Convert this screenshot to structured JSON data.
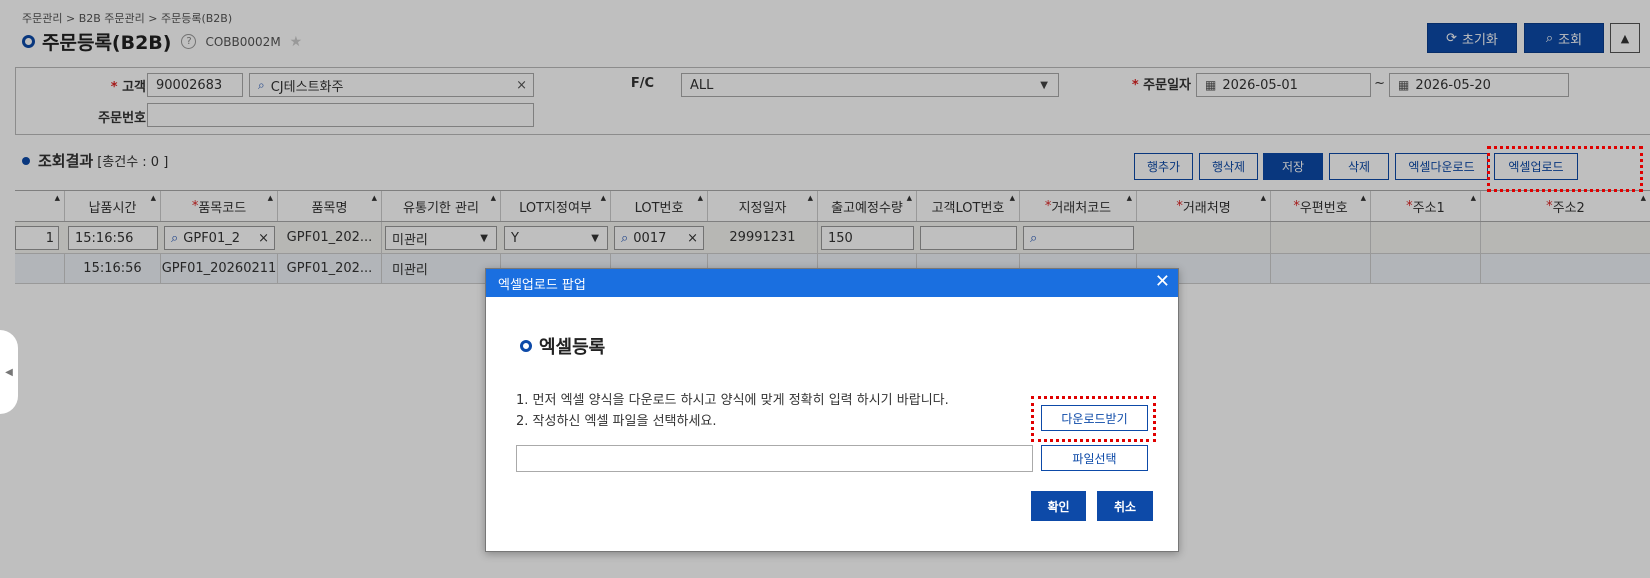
{
  "breadcrumb": "주문관리 > B2B 주문관리 > 주문등록(B2B)",
  "page": {
    "title": "주문등록(B2B)",
    "screen_code": "COBB0002M",
    "help": "?",
    "star": "★"
  },
  "top_buttons": {
    "reset_label": "초기화",
    "reset_icon": "⟳",
    "search_label": "조회",
    "search_icon": "⌕",
    "collapse_icon": "▲"
  },
  "filters": {
    "customer_label": "고객",
    "required_mark": "*",
    "customer_code": "90002683",
    "customer_name": "CJ테스트화주",
    "fc_label": "F/C",
    "fc_value": "ALL",
    "order_date_label": "주문일자",
    "date_from": "2026-05-01",
    "date_to": "2026-05-20",
    "tilde": "~",
    "order_no_label": "주문번호",
    "order_no_value": "",
    "search_icon": "⌕",
    "clear_icon": "×",
    "caret_icon": "▼",
    "calendar_icon": "▦"
  },
  "result": {
    "title": "조회결과",
    "count_text": "[총건수 :   0 ]"
  },
  "actions": [
    "행추가",
    "행삭제",
    "저장",
    "삭제",
    "엑셀다운로드",
    "엑셀업로드"
  ],
  "grid": {
    "columns": [
      "",
      "납품시간",
      "품목코드",
      "품목명",
      "유통기한 관리",
      "LOT지정여부",
      "LOT번호",
      "지정일자",
      "출고예정수량",
      "고객LOT번호",
      "거래처코드",
      "거래처명",
      "우편번호",
      "주소1",
      "주소2"
    ],
    "sort_icon": "▲",
    "edit_row": {
      "c0": "1",
      "delivery_time": "15:16:56",
      "item_code": "GPF01_2",
      "item_name": "GPF01_202...",
      "expiry": "미관리",
      "lot_flag": "Y",
      "lot_no": "0017",
      "date": "29991231",
      "qty": "150"
    },
    "view_row": {
      "delivery_time": "15:16:56",
      "item_code": "GPF01_20260211",
      "item_name": "GPF01_202...",
      "expiry": "미관리"
    }
  },
  "modal": {
    "header": "엑셀업로드 팝업",
    "close_icon": "✕",
    "subtitle": "엑셀등록",
    "instruction_1": "1. 먼저 엑셀 양식을 다운로드 하시고 양식에 맞게 정확히 입력 하시기 바랍니다.",
    "instruction_2": "2. 작성하신 엑셀 파일을 선택하세요.",
    "download_label": "다운로드받기",
    "file_select_label": "파일선택",
    "confirm_label": "확인",
    "cancel_label": "취소"
  },
  "side_handle_icon": "◀",
  "colors": {
    "primary": "#0d4aa8",
    "modal_header": "#1a6fe0",
    "highlight": "#e00000"
  }
}
